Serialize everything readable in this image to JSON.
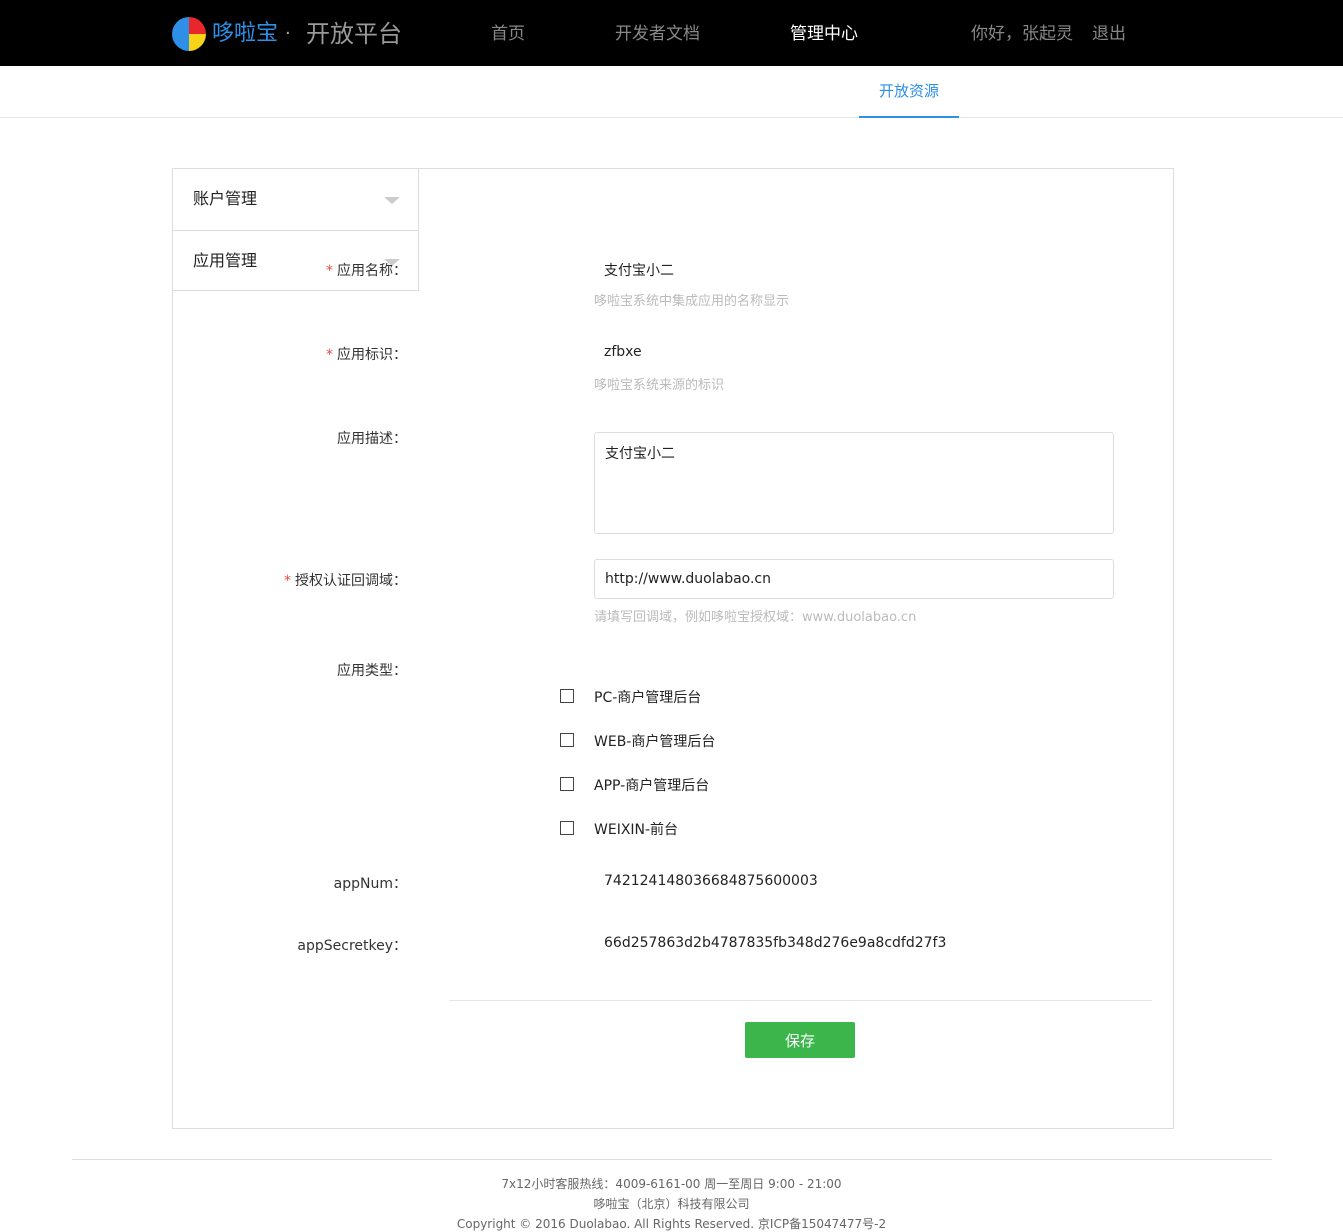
{
  "header": {
    "brand": "哆啦宝",
    "dot": "·",
    "platform": "开放平台",
    "nav": [
      "首页",
      "开发者文档",
      "管理中心"
    ],
    "active_nav": "管理中心",
    "greeting": "你好，张起灵",
    "logout": "退出"
  },
  "subnav": {
    "tab": "开放资源"
  },
  "sidebar": {
    "items": [
      {
        "label": "账户管理"
      },
      {
        "label": "应用管理"
      }
    ]
  },
  "form": {
    "app_name": {
      "label": "应用名称：",
      "value": "支付宝小二",
      "hint": "哆啦宝系统中集成应用的名称显示"
    },
    "app_id": {
      "label": "应用标识：",
      "value": "zfbxe",
      "hint": "哆啦宝系统来源的标识"
    },
    "app_desc": {
      "label": "应用描述：",
      "value": "支付宝小二"
    },
    "callback": {
      "label": "授权认证回调域：",
      "value": "http://www.duolabao.cn",
      "hint": "请填写回调域，例如哆啦宝授权域：www.duolabao.cn"
    },
    "app_type": {
      "label": "应用类型：",
      "options": [
        "PC-商户管理后台",
        "WEB-商户管理后台",
        "APP-商户管理后台",
        "WEIXIN-前台"
      ]
    },
    "app_num": {
      "label": "appNum：",
      "value": "742124148036684875600003"
    },
    "app_secret": {
      "label": "appSecretkey：",
      "value": "66d257863d2b4787835fb348d276e9a8cdfd27f3"
    },
    "required_mark": "*",
    "save": "保存"
  },
  "footer": {
    "hotline": "7x12小时客服热线：4009-6161-00 周一至周日 9:00 - 21:00",
    "company": "哆啦宝（北京）科技有限公司",
    "copyright": "Copyright © 2016 Duolabao. All Rights Reserved. 京ICP备15047477号-2"
  },
  "colors": {
    "accent": "#2d8fe6",
    "save": "#3cb64a",
    "required": "#e74c3c",
    "topbar": "#000000"
  }
}
